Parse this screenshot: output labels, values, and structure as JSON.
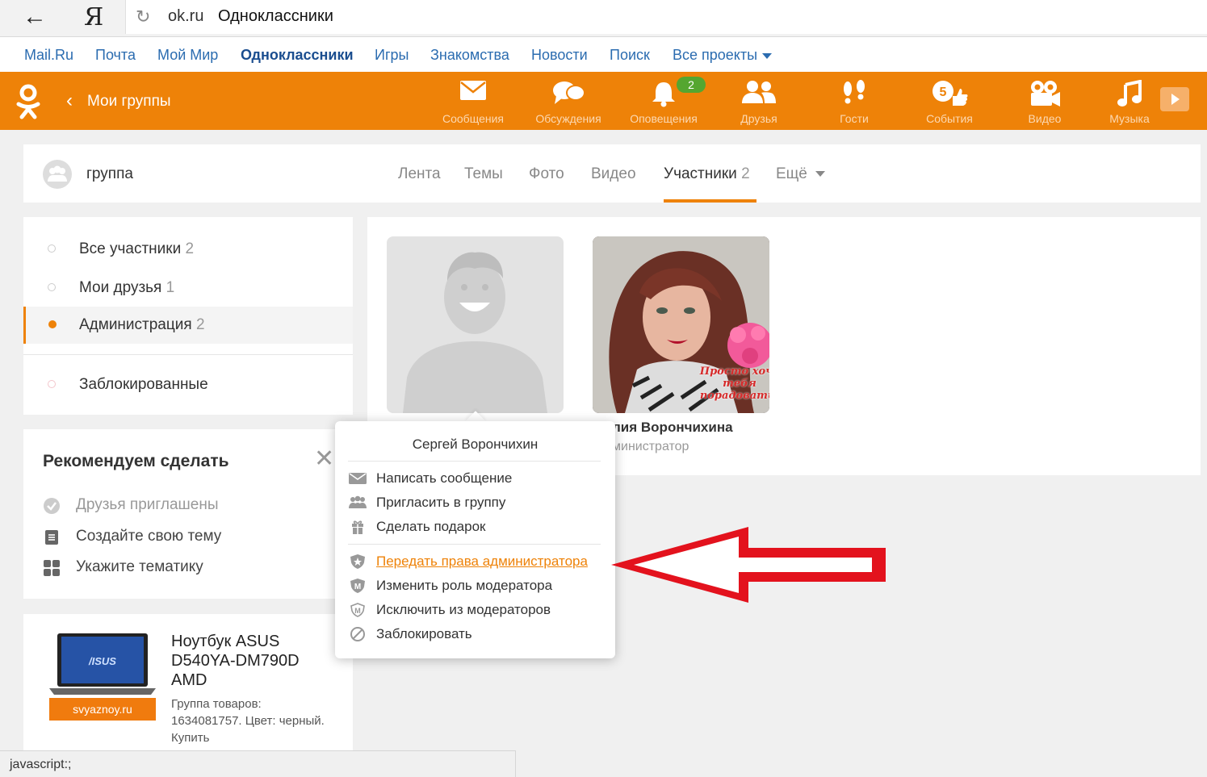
{
  "browser": {
    "back_icon": "←",
    "logo": "Я",
    "reload_icon": "↻",
    "url_domain": "ok.ru",
    "url_title": "Одноклассники"
  },
  "portal_nav": {
    "items": [
      "Mail.Ru",
      "Почта",
      "Мой Мир",
      "Одноклассники",
      "Игры",
      "Знакомства",
      "Новости",
      "Поиск",
      "Все проекты"
    ],
    "active": "Одноклассники"
  },
  "toolbar": {
    "back_icon": "‹",
    "section_title": "Мои группы",
    "accent_color": "#ee8208",
    "items": [
      {
        "label": "Сообщения",
        "icon": "envelope-icon"
      },
      {
        "label": "Обсуждения",
        "icon": "discussions-icon"
      },
      {
        "label": "Оповещения",
        "icon": "bell-icon"
      },
      {
        "label": "Друзья",
        "icon": "friends-icon"
      },
      {
        "label": "Гости",
        "icon": "footprints-icon"
      },
      {
        "label": "События",
        "icon": "events-icon"
      },
      {
        "label": "Видео",
        "icon": "video-camera-icon"
      },
      {
        "label": "Музыка",
        "icon": "music-note-icon"
      }
    ],
    "notifications_badge": "2"
  },
  "group": {
    "name": "группа",
    "tabs": [
      {
        "label": "Лента",
        "count": ""
      },
      {
        "label": "Темы",
        "count": ""
      },
      {
        "label": "Фото",
        "count": ""
      },
      {
        "label": "Видео",
        "count": ""
      },
      {
        "label": "Участники",
        "count": "2"
      },
      {
        "label": "Ещё",
        "count": ""
      }
    ],
    "active_tab": "Участники"
  },
  "filters": {
    "items": [
      {
        "label": "Все участники",
        "count": "2"
      },
      {
        "label": "Мои друзья",
        "count": "1"
      },
      {
        "label": "Администрация",
        "count": "2"
      },
      {
        "label": "Заблокированные",
        "count": ""
      }
    ],
    "active": "Администрация"
  },
  "recommend": {
    "title": "Рекомендуем сделать",
    "close_icon": "✕",
    "items": [
      {
        "label": "Друзья приглашены",
        "icon": "check-circle-icon",
        "done": true
      },
      {
        "label": "Создайте свою тему",
        "icon": "document-icon",
        "done": false
      },
      {
        "label": "Укажите тематику",
        "icon": "grid-icon",
        "done": false
      }
    ]
  },
  "ad": {
    "badge": "svyaznoy.ru",
    "laptop_brand": "/ISUS",
    "title": "Ноутбук ASUS D540YA-DM790D AMD",
    "description": "Группа товаров: 1634081757. Цвет: черный. Купить"
  },
  "members": {
    "second_name_visible": "лия Ворончихина",
    "second_role_visible": "министратор",
    "photo_caption": "Просто хочу тебя порадовать!"
  },
  "popup": {
    "name": "Сергей Ворончихин",
    "group1": [
      {
        "label": "Написать сообщение",
        "icon": "envelope-icon"
      },
      {
        "label": "Пригласить в группу",
        "icon": "invite-users-icon"
      },
      {
        "label": "Сделать подарок",
        "icon": "gift-icon"
      }
    ],
    "group2": [
      {
        "label": "Передать права администратора",
        "icon": "shield-star-icon"
      },
      {
        "label": "Изменить роль модератора",
        "icon": "shield-m-icon"
      },
      {
        "label": "Исключить из модераторов",
        "icon": "shield-m-outline-icon"
      },
      {
        "label": "Заблокировать",
        "icon": "block-icon"
      }
    ]
  },
  "status_bar": {
    "text": "javascript:;"
  }
}
